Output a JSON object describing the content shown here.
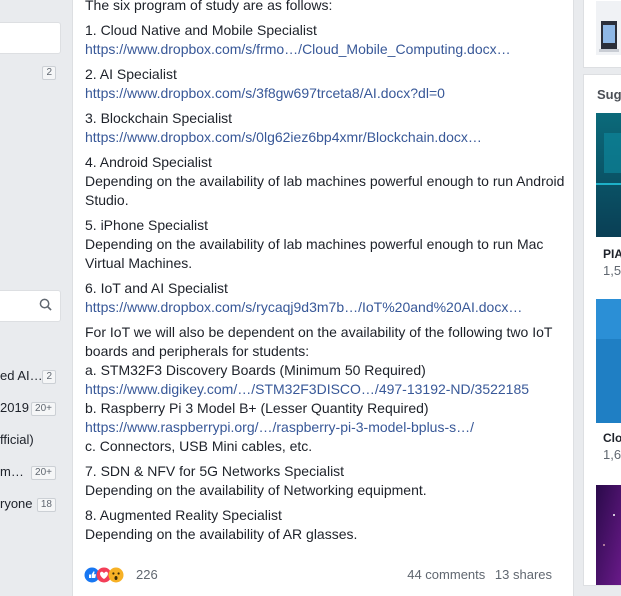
{
  "sidebar": {
    "rows": [
      {
        "text": "",
        "badge": "2"
      },
      {
        "text": "ed AI…",
        "badge": "2"
      },
      {
        "text": "2019",
        "badge": "20+"
      },
      {
        "text": "fficial)",
        "badge": ""
      },
      {
        "text": "m…",
        "badge": "20+"
      },
      {
        "text": "ryone",
        "badge": "18"
      }
    ]
  },
  "post": {
    "intro": "The six program of study are as follows:",
    "items": [
      {
        "title": "1. Cloud Native and Mobile Specialist",
        "link": "https://www.dropbox.com/s/frmo…/Cloud_Mobile_Computing.docx…"
      },
      {
        "title": "2. AI Specialist",
        "link": "https://www.dropbox.com/s/3f8gw697trceta8/AI.docx?dl=0"
      },
      {
        "title": "3. Blockchain Specialist",
        "link": "https://www.dropbox.com/s/0lg62iez6bp4xmr/Blockchain.docx…"
      },
      {
        "title": "4. Android Specialist",
        "note": "Depending on the availability of lab machines powerful enough to run Android Studio."
      },
      {
        "title": "5. iPhone Specialist",
        "note": "Depending on the availability of lab machines powerful enough to run Mac Virtual Machines."
      },
      {
        "title": "6. IoT and AI Specialist",
        "link": "https://www.dropbox.com/s/rycaqj9d3m7b…/IoT%20and%20AI.docx…"
      }
    ],
    "iot": {
      "intro": "For IoT we will also be dependent on the availability of the following two IoT boards and peripherals for students:",
      "a": "a. STM32F3 Discovery Boards (Minimum 50 Required)",
      "a_link": "https://www.digikey.com/…/STM32F3DISCO…/497-13192-ND/3522185",
      "b": "b. Raspberry Pi 3 Model B+ (Lesser Quantity Required)",
      "b_link": "https://www.raspberrypi.org/…/raspberry-pi-3-model-bplus-s…/",
      "c": "c. Connectors, USB Mini cables, etc."
    },
    "tail": [
      {
        "title": "7. SDN & NFV for 5G Networks Specialist",
        "note": "Depending on the availability of Networking equipment."
      },
      {
        "title": "8. Augmented Reality Specialist",
        "note": "Depending on the availability of AR glasses."
      }
    ],
    "reactions": {
      "count": "226",
      "comments": "44 comments",
      "shares": "13 shares"
    }
  },
  "right": {
    "suggested": "Sugg",
    "cards": [
      {
        "label": "PIA",
        "sub": "1,5"
      },
      {
        "label": "Clo",
        "sub": "1,6"
      }
    ]
  },
  "colors": {
    "link": "#385898",
    "bg": "#e9ebee"
  }
}
